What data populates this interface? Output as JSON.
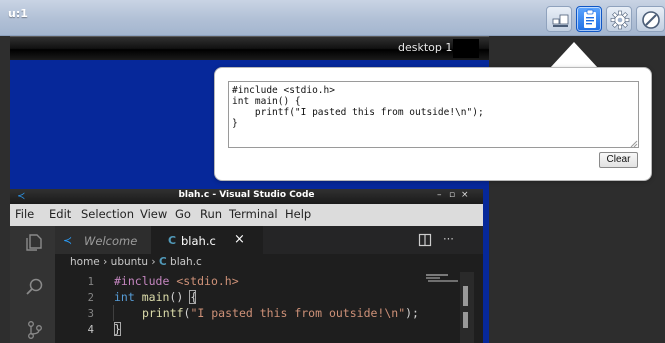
{
  "topbar": {
    "title": "u:1",
    "buttons": [
      {
        "icon": "display-icon"
      },
      {
        "icon": "clipboard-icon",
        "active": true
      },
      {
        "icon": "gear-icon"
      },
      {
        "icon": "disconnect-icon"
      }
    ]
  },
  "desktop_panel": {
    "label": "desktop 1"
  },
  "clipboard": {
    "text": "#include <stdio.h>\nint main() {\n    printf(\"I pasted this from outside!\\n\");\n}",
    "clear_label": "Clear"
  },
  "vscode": {
    "title": "blah.c - Visual Studio Code",
    "window_controls": [
      "–",
      "▫",
      "×"
    ],
    "menu": [
      "File",
      "Edit",
      "Selection",
      "View",
      "Go",
      "Run",
      "Terminal",
      "Help"
    ],
    "tabs": [
      {
        "label": "Welcome",
        "active": false
      },
      {
        "label": "blah.c",
        "active": true
      }
    ],
    "tab_icon_c": "C",
    "tab_close": "×",
    "breadcrumb": {
      "parts": [
        "home",
        "ubuntu",
        "blah.c"
      ],
      "sep": "›"
    },
    "line_numbers": [
      "1",
      "2",
      "3",
      "4"
    ],
    "code": {
      "l1_directive": "#include",
      "l1_header": "<stdio.h>",
      "l2_type": "int",
      "l2_func": "main",
      "l2_rest": "() {",
      "l3_func": "printf",
      "l3_paren_open": "(",
      "l3_string": "\"I pasted this from outside!\\n\"",
      "l3_rest": ");",
      "l4": "}"
    },
    "colors": {
      "keyword": "#c586c0",
      "type": "#569cd6",
      "function": "#dcdcaa",
      "string": "#ce9178",
      "text": "#d4d4d4"
    }
  }
}
